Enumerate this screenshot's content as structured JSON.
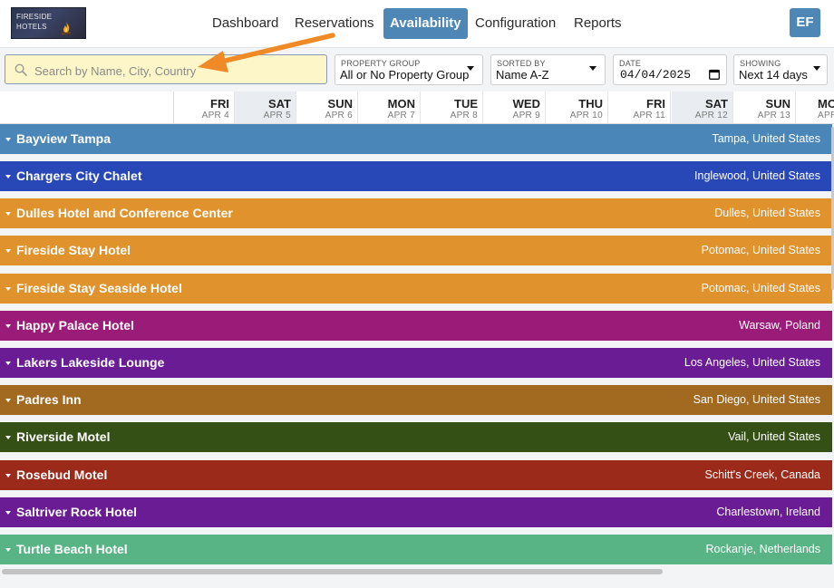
{
  "brand": {
    "logo_text": "FIRESIDE\nHOTELS"
  },
  "nav": {
    "items": [
      {
        "label": "Dashboard",
        "active": false
      },
      {
        "label": "Reservations",
        "active": false
      },
      {
        "label": "Availability",
        "active": true
      },
      {
        "label": "Configuration",
        "active": false
      },
      {
        "label": "Reports",
        "active": false
      }
    ],
    "avatar_initials": "EF",
    "accent_color": "#4e86b5"
  },
  "filters": {
    "search": {
      "placeholder": "Search by Name, City, Country",
      "value": ""
    },
    "property_group": {
      "label": "PROPERTY GROUP",
      "value": "All or No Property Group"
    },
    "sorted_by": {
      "label": "SORTED BY",
      "value": "Name A-Z"
    },
    "date": {
      "label": "DATE",
      "value": "04/04/2025"
    },
    "showing": {
      "label": "SHOWING",
      "value": "Next 14 days"
    }
  },
  "days": [
    {
      "dow": "FRI",
      "date": "APR 4",
      "weekend": false
    },
    {
      "dow": "SAT",
      "date": "APR 5",
      "weekend": true
    },
    {
      "dow": "SUN",
      "date": "APR 6",
      "weekend": false
    },
    {
      "dow": "MON",
      "date": "APR 7",
      "weekend": false
    },
    {
      "dow": "TUE",
      "date": "APR 8",
      "weekend": false
    },
    {
      "dow": "WED",
      "date": "APR 9",
      "weekend": false
    },
    {
      "dow": "THU",
      "date": "APR 10",
      "weekend": false
    },
    {
      "dow": "FRI",
      "date": "APR 11",
      "weekend": false
    },
    {
      "dow": "SAT",
      "date": "APR 12",
      "weekend": true
    },
    {
      "dow": "SUN",
      "date": "APR 13",
      "weekend": false
    },
    {
      "dow": "MO",
      "date": "APR",
      "weekend": false
    }
  ],
  "properties": [
    {
      "name": "Bayview Tampa",
      "location": "Tampa, United States",
      "color": "#4a87b8"
    },
    {
      "name": "Chargers City Chalet",
      "location": "Inglewood, United States",
      "color": "#2948b8"
    },
    {
      "name": "Dulles Hotel and Conference Center",
      "location": "Dulles, United States",
      "color": "#e0922d"
    },
    {
      "name": "Fireside Stay Hotel",
      "location": "Potomac, United States",
      "color": "#e0922d"
    },
    {
      "name": "Fireside Stay Seaside Hotel",
      "location": "Potomac, United States",
      "color": "#e0922d"
    },
    {
      "name": "Happy Palace Hotel",
      "location": "Warsaw, Poland",
      "color": "#9b1c78"
    },
    {
      "name": "Lakers Lakeside Lounge",
      "location": "Los Angeles, United States",
      "color": "#6a1c94"
    },
    {
      "name": "Padres Inn",
      "location": "San Diego, United States",
      "color": "#a26a20"
    },
    {
      "name": "Riverside Motel",
      "location": "Vail, United States",
      "color": "#355015"
    },
    {
      "name": "Rosebud Motel",
      "location": "Schitt's Creek, Canada",
      "color": "#9c2a1b"
    },
    {
      "name": "Saltriver Rock Hotel",
      "location": "Charlestown, Ireland",
      "color": "#6a1c94"
    },
    {
      "name": "Turtle Beach Hotel",
      "location": "Rockanje, Netherlands",
      "color": "#58b485"
    }
  ],
  "annotation": {
    "arrow_color": "#ef8a26"
  }
}
